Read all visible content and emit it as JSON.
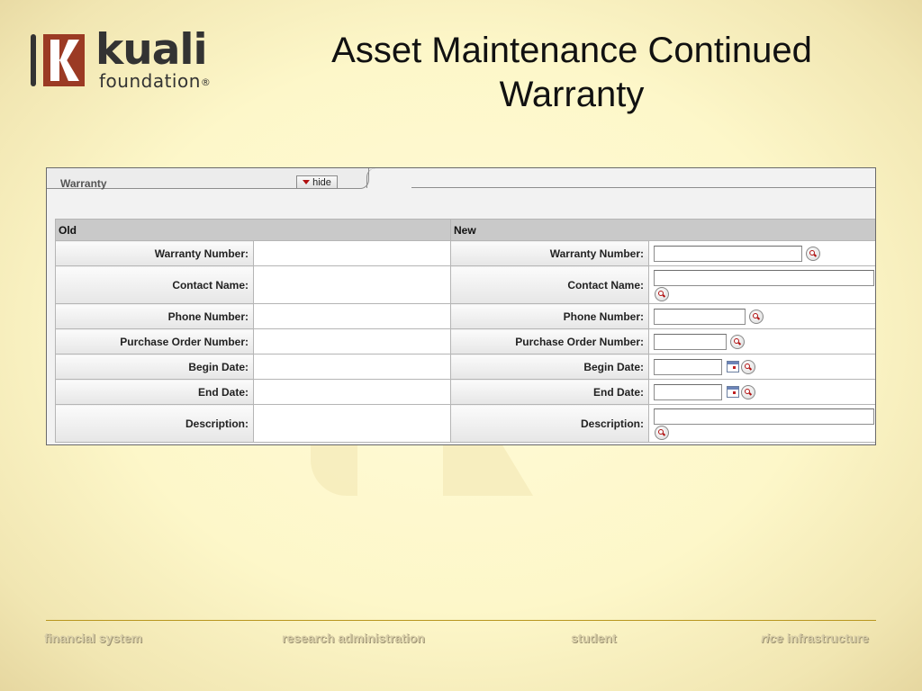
{
  "logo": {
    "word": "kuali",
    "sub": "foundation",
    "reg": "®"
  },
  "slide": {
    "title_line1": "Asset Maintenance Continued",
    "title_line2": "Warranty"
  },
  "panel": {
    "tab_label": "Warranty",
    "hide_label": "hide",
    "col_old": "Old",
    "col_new": "New",
    "rows": [
      {
        "label": "Warranty Number:",
        "controls": [
          "text-input",
          "lookup"
        ]
      },
      {
        "label": "Contact Name:",
        "controls": [
          "text-input",
          "lookup"
        ]
      },
      {
        "label": "Phone Number:",
        "controls": [
          "text-input",
          "lookup"
        ]
      },
      {
        "label": "Purchase Order Number:",
        "controls": [
          "text-input",
          "lookup"
        ]
      },
      {
        "label": "Begin Date:",
        "controls": [
          "date-input",
          "calendar",
          "lookup"
        ]
      },
      {
        "label": "End Date:",
        "controls": [
          "date-input",
          "calendar",
          "lookup"
        ]
      },
      {
        "label": "Description:",
        "controls": [
          "text-input",
          "lookup"
        ]
      }
    ]
  },
  "footer": {
    "financial": "financial system",
    "research": "research administration",
    "student": "student",
    "rice_it": "rice",
    "rice_rest": " infrastructure"
  },
  "icons": {
    "lookup": "magnifier-icon",
    "calendar": "calendar-icon",
    "hide": "triangle-down-icon"
  },
  "colors": {
    "brand": "#9b3a24",
    "background": "#fdf7c9",
    "rule": "#b8961e"
  }
}
